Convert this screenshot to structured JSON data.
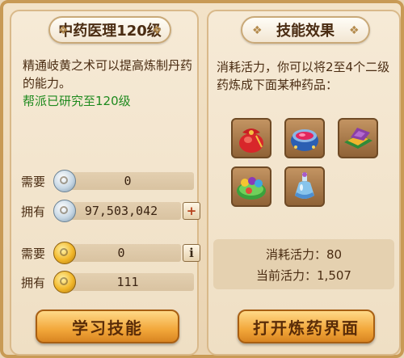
{
  "left_panel": {
    "title": "中药医理120级",
    "description": "精通岐黄之术可以提高炼制丹药的能力。",
    "research_status": "帮派已研究至120级",
    "rows": [
      {
        "label": "需要",
        "value": "0"
      },
      {
        "label": "拥有",
        "value": "97,503,042"
      },
      {
        "label": "需要",
        "value": "0"
      },
      {
        "label": "拥有",
        "value": "111"
      }
    ],
    "add_icon": "+",
    "info_icon": "i",
    "learn_button": "学习技能"
  },
  "right_panel": {
    "title": "技能效果",
    "description": "消耗活力，你可以将2至4个二级药炼成下面某种药品：",
    "items": [
      "pouch-icon",
      "red-cauldron-icon",
      "powder-box-icon",
      "green-pills-icon",
      "potion-bottle-icon"
    ],
    "stats": {
      "cost": "消耗活力：80",
      "current": "当前活力：1,507"
    },
    "open_button": "打开炼药界面"
  },
  "colors": {
    "accent_green": "#1e8a1e",
    "button_orange": "#f2a73a",
    "text_brown": "#4a2c12"
  }
}
